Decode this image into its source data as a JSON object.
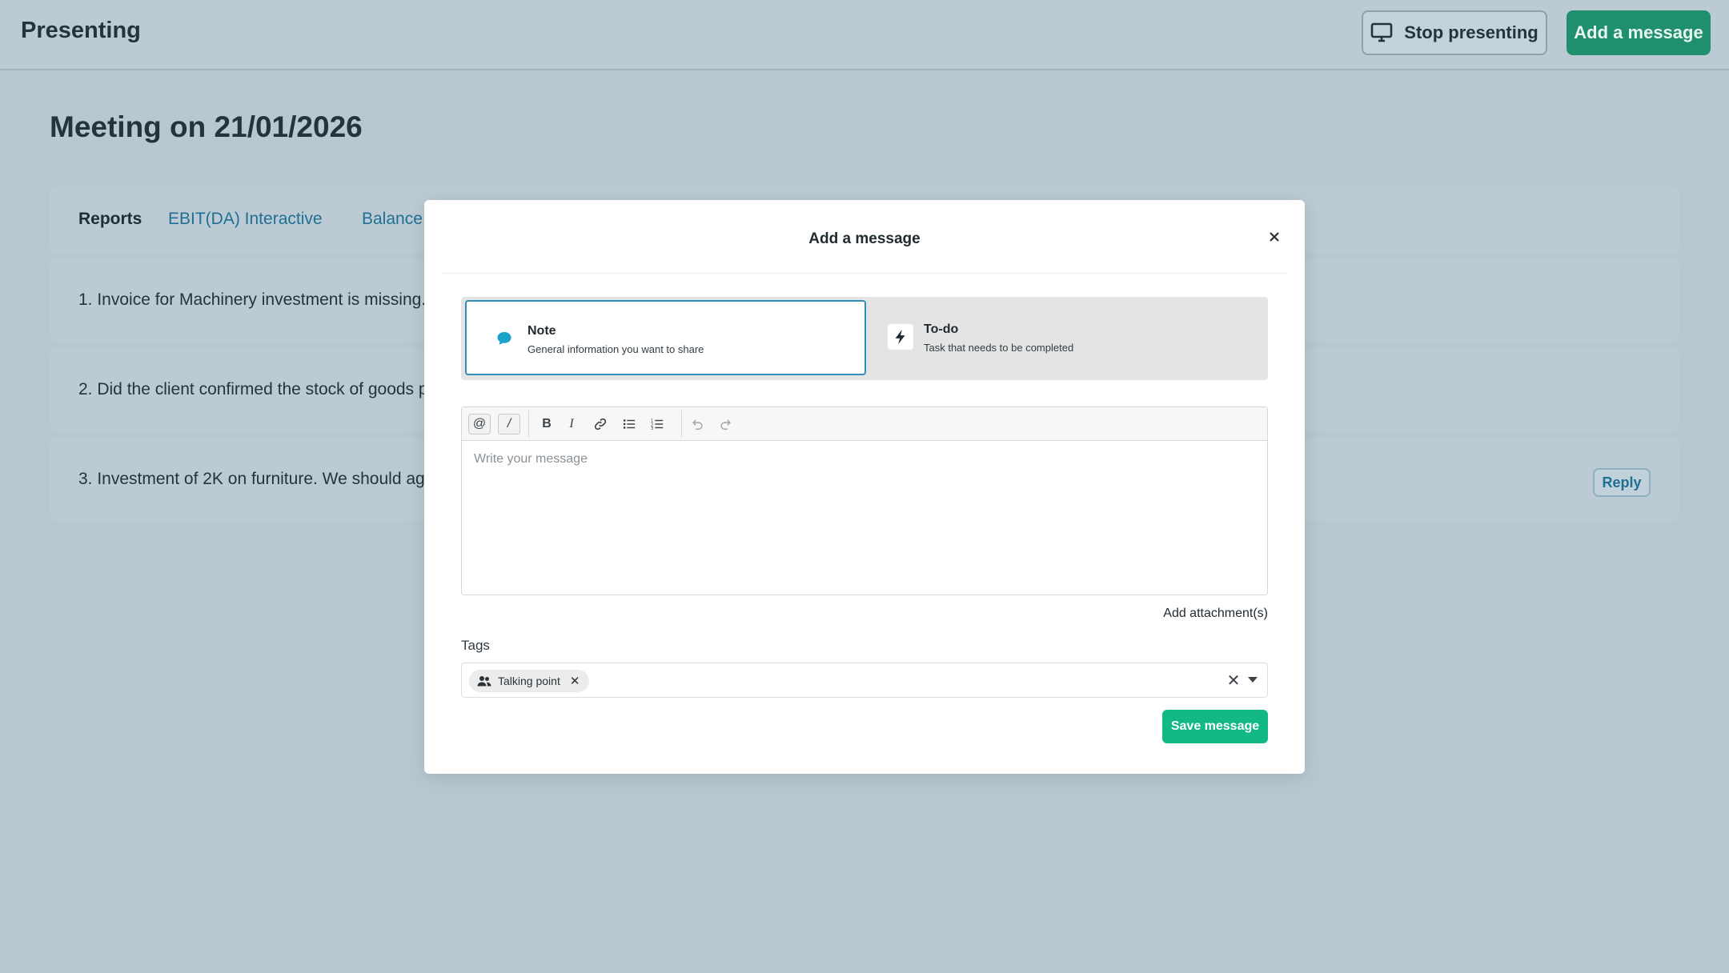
{
  "topbar": {
    "title": "Presenting",
    "stop_presenting_label": "Stop presenting",
    "add_message_label": "Add a message"
  },
  "page": {
    "title": "Meeting on 21/01/2026",
    "tabs": [
      {
        "label": "Reports",
        "active": true
      },
      {
        "label": "EBIT(DA) Interactive",
        "active": false
      },
      {
        "label": "Balance",
        "active": false
      }
    ],
    "items": [
      {
        "text": "1. Invoice for Machinery investment is missing."
      },
      {
        "text": "2. Did the client confirmed the stock of goods p"
      },
      {
        "text": "3. Investment of 2K on furniture. We should agr",
        "reply_label": "Reply"
      }
    ]
  },
  "modal": {
    "title": "Add a message",
    "close_icon": "close-icon",
    "types": [
      {
        "label": "Note",
        "description": "General information you want to share",
        "icon": "speech-bubble-icon",
        "icon_color": "#1aa3c8",
        "selected": true
      },
      {
        "label": "To-do",
        "description": "Task that needs to be completed",
        "icon": "lightning-icon",
        "selected": false
      }
    ],
    "toolbar": {
      "mention": "@",
      "slash": "/",
      "bold": "B",
      "italic": "I"
    },
    "editor_placeholder": "Write your message",
    "add_attachment_label": "Add attachment(s)",
    "tags_label": "Tags",
    "tags": [
      {
        "label": "Talking point",
        "icon": "people-icon"
      }
    ],
    "save_label": "Save message"
  },
  "colors": {
    "primary_green": "#12b886",
    "accent_blue": "#2f8fb8",
    "overlay_bg": "#b8c8d1"
  }
}
